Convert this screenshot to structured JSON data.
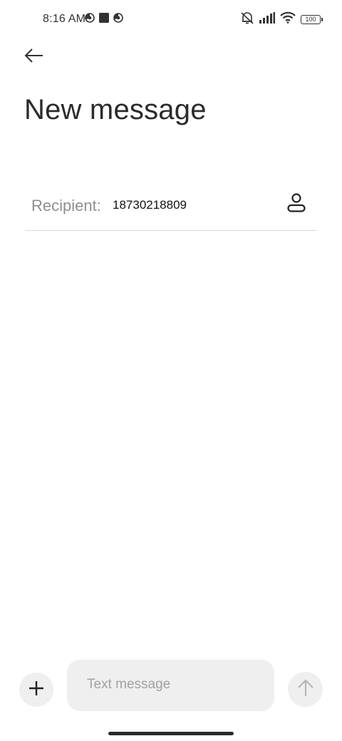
{
  "status_bar": {
    "time": "8:16 AM",
    "left_icons": [
      "timer-icon",
      "stop-square-icon",
      "timer-icon"
    ],
    "right_icons": [
      "vibrate-off-icon",
      "signal-icon",
      "wifi-icon",
      "battery-icon"
    ],
    "battery_level": "100"
  },
  "header": {
    "back_icon": "arrow-left-icon",
    "title": "New message"
  },
  "recipient": {
    "label": "Recipient:",
    "value": "18730218809",
    "contact_icon": "person-icon"
  },
  "composer": {
    "add_icon": "plus-icon",
    "placeholder": "Text message",
    "send_icon": "arrow-up-icon"
  },
  "colors": {
    "background": "#ffffff",
    "composer_bg": "#efefef",
    "placeholder": "#a2a2a2",
    "label": "#8e8e8e",
    "divider": "#d8d8d8"
  }
}
